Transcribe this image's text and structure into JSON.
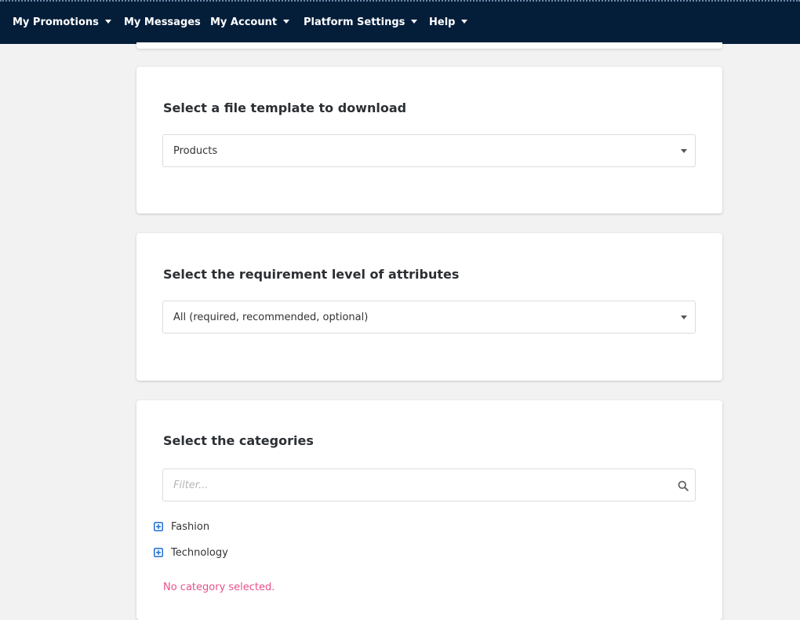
{
  "nav": {
    "items": [
      {
        "label": "My Promotions",
        "has_dropdown": true
      },
      {
        "label": "My Messages",
        "has_dropdown": false
      },
      {
        "label": "My Account",
        "has_dropdown": true
      },
      {
        "label": "Platform Settings",
        "has_dropdown": true
      },
      {
        "label": "Help",
        "has_dropdown": true
      }
    ]
  },
  "template_card": {
    "title": "Select a file template to download",
    "selected": "Products"
  },
  "requirement_card": {
    "title": "Select the requirement level of attributes",
    "selected": "All (required, recommended, optional)"
  },
  "categories_card": {
    "title": "Select the categories",
    "filter_placeholder": "Filter...",
    "filter_value": "",
    "tree": [
      {
        "label": "Fashion",
        "expanded": false
      },
      {
        "label": "Technology",
        "expanded": false
      }
    ],
    "status": "No category selected."
  },
  "colors": {
    "nav_background": "#041e3a",
    "accent_blue": "#1f6ed4",
    "status_pink": "#e8508a"
  },
  "icons": {
    "dropdown": "caret-down-icon",
    "search": "search-icon",
    "tree_expand": "plus-square-icon"
  }
}
